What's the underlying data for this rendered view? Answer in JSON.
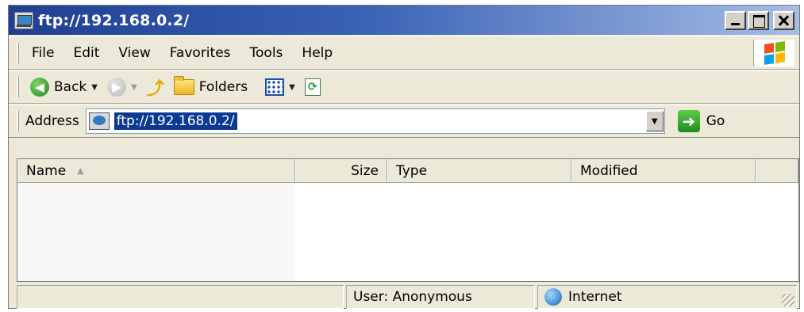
{
  "window": {
    "title": "ftp://192.168.0.2/"
  },
  "menubar": {
    "items": [
      {
        "label": "File"
      },
      {
        "label": "Edit"
      },
      {
        "label": "View"
      },
      {
        "label": "Favorites"
      },
      {
        "label": "Tools"
      },
      {
        "label": "Help"
      }
    ]
  },
  "toolbar": {
    "back_label": "Back",
    "folders_label": "Folders"
  },
  "addressbar": {
    "label": "Address",
    "value": "ftp://192.168.0.2/",
    "go_label": "Go"
  },
  "columns": [
    {
      "label": "Name"
    },
    {
      "label": "Size"
    },
    {
      "label": "Type"
    },
    {
      "label": "Modified"
    }
  ],
  "statusbar": {
    "user": "User: Anonymous",
    "zone": "Internet"
  },
  "colors": {
    "title_bar_start": "#1f3f93",
    "title_bar_end": "#a6bde6",
    "selection": "#0b3a94",
    "chrome": "#ece9d8"
  }
}
